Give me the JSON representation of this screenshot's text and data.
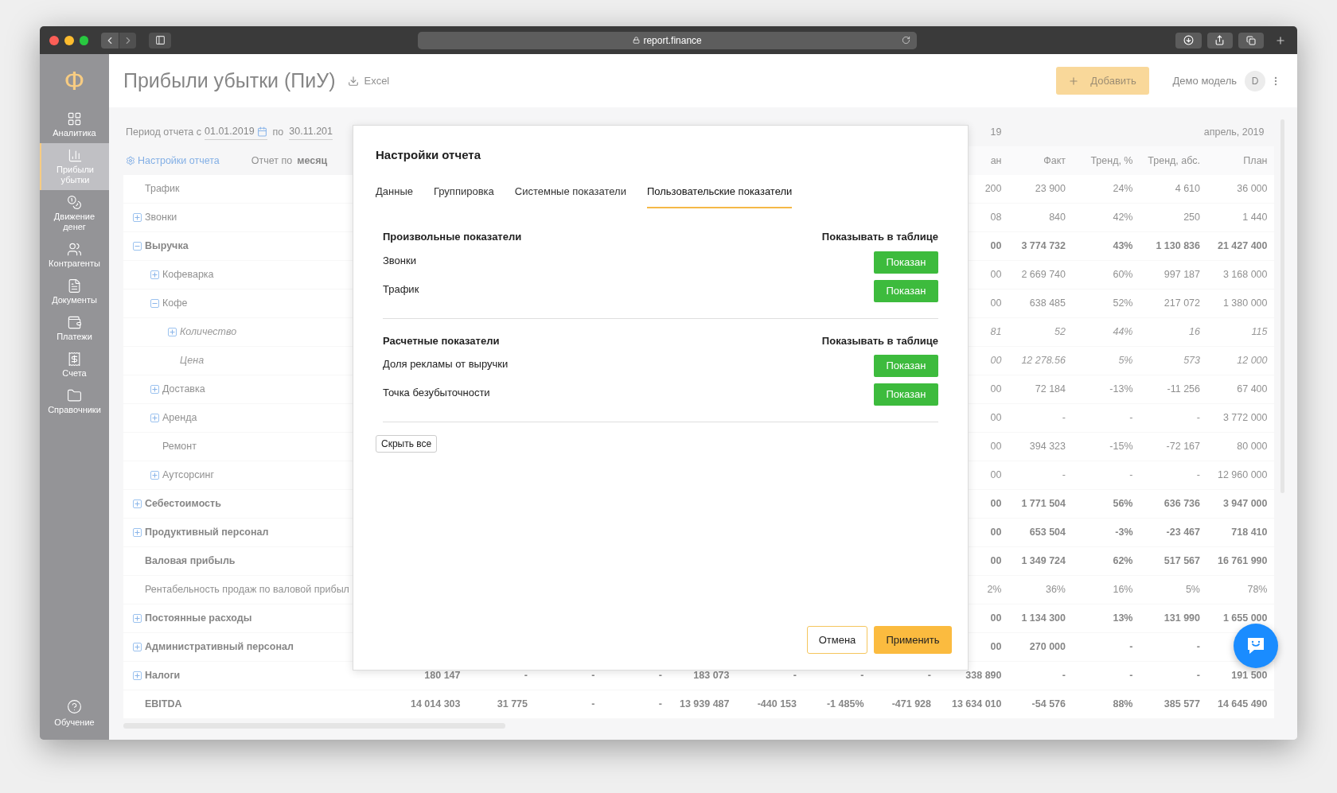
{
  "browser": {
    "url": "report.finance"
  },
  "sidebar": {
    "logo": "Ф",
    "items": [
      {
        "label": "Аналитика",
        "selected": false
      },
      {
        "label": "Прибыли убытки",
        "selected": true
      },
      {
        "label": "Движение денег",
        "selected": false
      },
      {
        "label": "Контрагенты",
        "selected": false
      },
      {
        "label": "Документы",
        "selected": false
      },
      {
        "label": "Платежи",
        "selected": false
      },
      {
        "label": "Счета",
        "selected": false
      },
      {
        "label": "Справочники",
        "selected": false
      }
    ],
    "help": {
      "label": "Обучение"
    }
  },
  "header": {
    "title": "Прибыли убытки (ПиУ)",
    "export": "Excel",
    "add_button": "Добавить",
    "model": "Демо модель",
    "avatar": "D"
  },
  "filters": {
    "period_label": "Период отчета с",
    "date_from": "01.01.2019",
    "to_label": "по",
    "date_to": "30.11.201",
    "settings_link": "Настройки отчета",
    "report_by_label": "Отчет по",
    "report_by": "месяц"
  },
  "table": {
    "group_headers": [
      "19",
      "апрель, 2019"
    ],
    "columns": [
      "ан",
      "Факт",
      "Тренд, %",
      "Тренд, абс.",
      "План"
    ],
    "rows": [
      {
        "label": "Трафик",
        "kind": "plain",
        "values": [
          "200",
          "23 900",
          "24%",
          "4 610",
          "36 000"
        ]
      },
      {
        "label": "Звонки",
        "kind": "plain",
        "expanded": false,
        "values": [
          "08",
          "840",
          "42%",
          "250",
          "1 440"
        ]
      },
      {
        "label": "Выручка",
        "kind": "total",
        "expanded": true,
        "values": [
          "00",
          "3 774 732",
          "43%",
          "1 130 836",
          "21 427 400"
        ],
        "children": [
          {
            "label": "Кофеварка",
            "kind": "plain",
            "expanded": false,
            "values": [
              "00",
              "2 669 740",
              "60%",
              "997 187",
              "3 168 000"
            ]
          },
          {
            "label": "Кофе",
            "kind": "plain",
            "expanded": true,
            "values": [
              "00",
              "638 485",
              "52%",
              "217 072",
              "1 380 000"
            ],
            "children": [
              {
                "label": "Количество",
                "kind": "derived",
                "expanded": false,
                "values": [
                  "81",
                  "52",
                  "44%",
                  "16",
                  "115"
                ]
              },
              {
                "label": "Цена",
                "kind": "derived",
                "values": [
                  "00",
                  "12 278.56",
                  "5%",
                  "573",
                  "12 000"
                ]
              }
            ]
          },
          {
            "label": "Доставка",
            "kind": "plain",
            "expanded": false,
            "values": [
              "00",
              "72 184",
              "-13%",
              "-11 256",
              "67 400"
            ]
          },
          {
            "label": "Аренда",
            "kind": "plain",
            "expanded": false,
            "values": [
              "00",
              "-",
              "-",
              "-",
              "3 772 000"
            ]
          },
          {
            "label": "Ремонт",
            "kind": "plain",
            "values": [
              "00",
              "394 323",
              "-15%",
              "-72 167",
              "80 000"
            ]
          },
          {
            "label": "Аутсорсинг",
            "kind": "plain",
            "expanded": false,
            "values": [
              "00",
              "-",
              "-",
              "-",
              "12 960 000"
            ]
          }
        ]
      },
      {
        "label": "Себестоимость",
        "kind": "total",
        "expanded": false,
        "values": [
          "00",
          "1 771 504",
          "56%",
          "636 736",
          "3 947 000"
        ]
      },
      {
        "label": "Продуктивный персонал",
        "kind": "total",
        "expanded": false,
        "values": [
          "00",
          "653 504",
          "-3%",
          "-23 467",
          "718 410"
        ]
      },
      {
        "label": "Валовая прибыль",
        "kind": "total",
        "values": [
          "00",
          "1 349 724",
          "62%",
          "517 567",
          "16 761 990"
        ]
      },
      {
        "label": "Рентабельность продаж по валовой прибыл",
        "kind": "plain",
        "values": [
          "2%",
          "36%",
          "16%",
          "5%",
          "78%"
        ]
      },
      {
        "label": "Постоянные расходы",
        "kind": "total",
        "expanded": false,
        "values": [
          "00",
          "1 134 300",
          "13%",
          "131 990",
          "1 655 000"
        ]
      },
      {
        "label": "Административный персонал",
        "kind": "total",
        "expanded": false,
        "values": [
          "00",
          "270 000",
          "-",
          "-"
        ]
      },
      {
        "label": "Налоги",
        "kind": "total",
        "expanded": false,
        "values": [
          "180 147",
          "-",
          "-",
          "-",
          "183 073",
          "-",
          "-",
          "-",
          "338 890",
          "-",
          "-",
          "-",
          "191 500"
        ]
      },
      {
        "label": "EBITDA",
        "kind": "total",
        "values": [
          "14 014 303",
          "31 775",
          "-",
          "-",
          "13 939 487",
          "-440 153",
          "-1 485%",
          "-471 928",
          "13 634 010",
          "-54 576",
          "88%",
          "385 577",
          "14 645 490"
        ]
      }
    ]
  },
  "dialog": {
    "title": "Настройки отчета",
    "tabs": [
      {
        "label": "Данные",
        "selected": false
      },
      {
        "label": "Группировка",
        "selected": false
      },
      {
        "label": "Системные показатели",
        "selected": false
      },
      {
        "label": "Пользовательские показатели",
        "selected": true
      }
    ],
    "sections": [
      {
        "title": "Произвольные показатели",
        "column": "Показывать в таблице",
        "items": [
          {
            "label": "Звонки",
            "shown": true,
            "button": "Показан"
          },
          {
            "label": "Трафик",
            "shown": true,
            "button": "Показан"
          }
        ]
      },
      {
        "title": "Расчетные показатели",
        "column": "Показывать в таблице",
        "items": [
          {
            "label": "Доля рекламы от выручки",
            "shown": true,
            "button": "Показан"
          },
          {
            "label": "Точка безубыточности",
            "shown": true,
            "button": "Показан"
          }
        ]
      }
    ],
    "hide_all": "Скрыть все",
    "cancel": "Отмена",
    "apply": "Применить"
  }
}
